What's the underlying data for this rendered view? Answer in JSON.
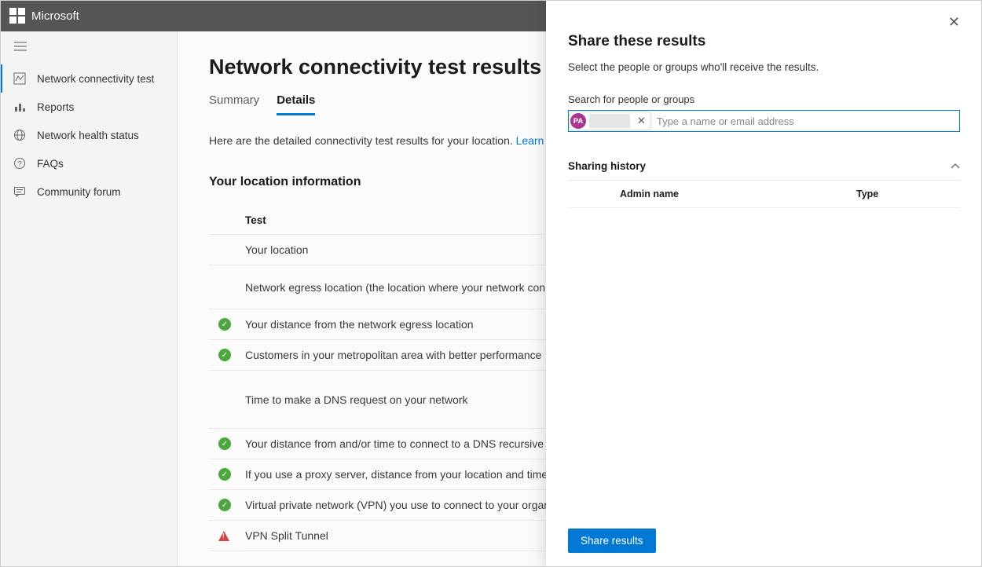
{
  "header": {
    "brand": "Microsoft"
  },
  "sidebar": {
    "items": [
      {
        "label": "Network connectivity test"
      },
      {
        "label": "Reports"
      },
      {
        "label": "Network health status"
      },
      {
        "label": "FAQs"
      },
      {
        "label": "Community forum"
      }
    ]
  },
  "main": {
    "title": "Network connectivity test results for you",
    "tabs": [
      {
        "label": "Summary"
      },
      {
        "label": "Details"
      }
    ],
    "intro_text": "Here are the detailed connectivity test results for your location. ",
    "intro_link": "Learn about the tests v",
    "section_title": "Your location information",
    "table_header": "Test",
    "rows": [
      {
        "status": "",
        "text": "Your location"
      },
      {
        "status": "",
        "text": "Network egress location (the location where your network connects to you"
      },
      {
        "status": "ok",
        "text": "Your distance from the network egress location"
      },
      {
        "status": "ok",
        "text": "Customers in your metropolitan area with better performance"
      },
      {
        "status": "",
        "text": "Time to make a DNS request on your network"
      },
      {
        "status": "ok",
        "text": "Your distance from and/or time to connect to a DNS recursive resolver"
      },
      {
        "status": "ok",
        "text": "If you use a proxy server, distance from your location and time to connect"
      },
      {
        "status": "ok",
        "text": "Virtual private network (VPN) you use to connect to your organization"
      },
      {
        "status": "warn",
        "text": "VPN Split Tunnel"
      }
    ]
  },
  "panel": {
    "title": "Share these results",
    "subtitle": "Select the people or groups who'll receive the results.",
    "search_label": "Search for people or groups",
    "chip_initials": "PA",
    "input_placeholder": "Type a name or email address",
    "history_title": "Sharing history",
    "columns": {
      "admin": "Admin name",
      "type": "Type"
    },
    "share_button": "Share results"
  }
}
